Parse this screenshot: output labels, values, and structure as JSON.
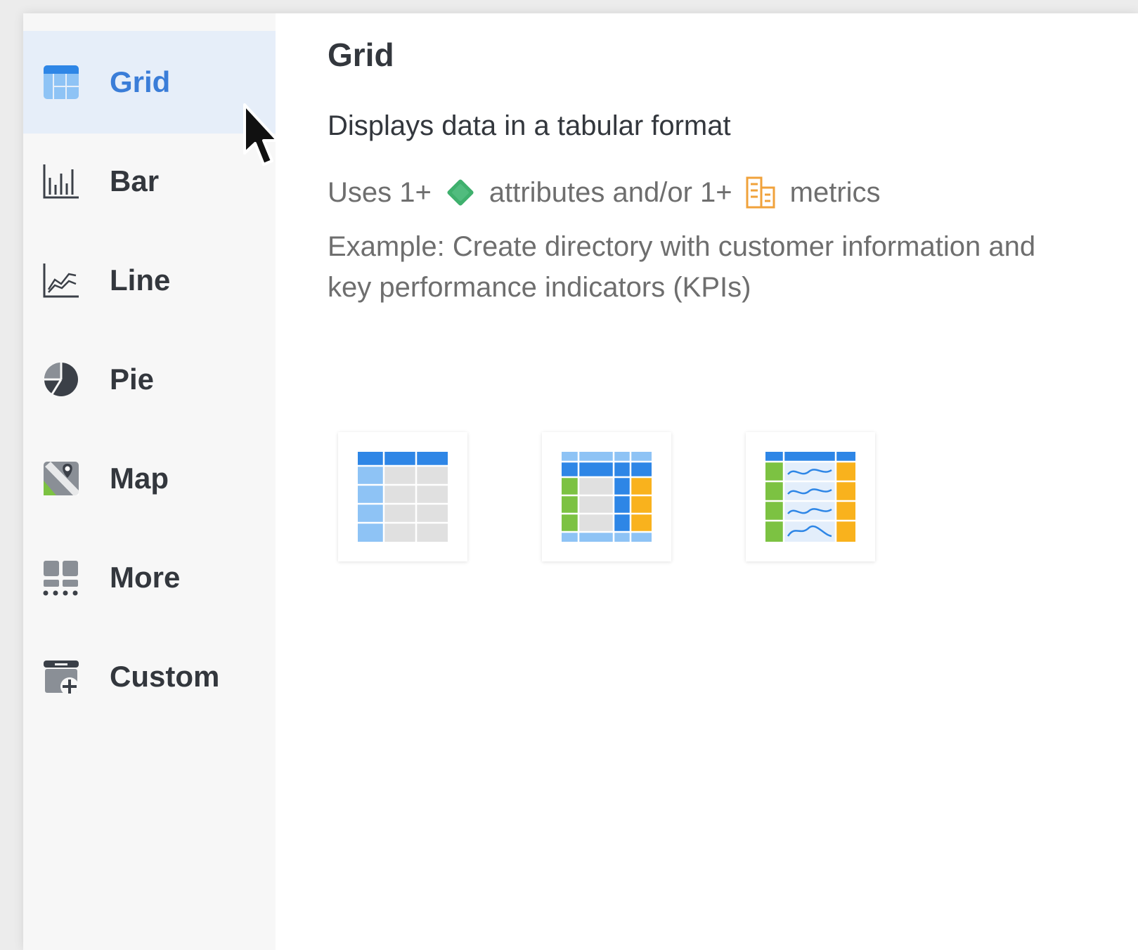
{
  "sidebar": {
    "items": [
      {
        "label": "Grid",
        "icon": "grid-icon",
        "active": true
      },
      {
        "label": "Bar",
        "icon": "bar-chart-icon",
        "active": false
      },
      {
        "label": "Line",
        "icon": "line-chart-icon",
        "active": false
      },
      {
        "label": "Pie",
        "icon": "pie-chart-icon",
        "active": false
      },
      {
        "label": "Map",
        "icon": "map-icon",
        "active": false
      },
      {
        "label": "More",
        "icon": "more-icon",
        "active": false
      },
      {
        "label": "Custom",
        "icon": "custom-icon",
        "active": false
      }
    ]
  },
  "detail": {
    "title": "Grid",
    "description": "Displays data in a tabular format",
    "uses_prefix": "Uses 1+",
    "uses_attributes": "attributes and/or 1+",
    "uses_metrics": "metrics",
    "example": "Example: Create directory with customer information and key performance indicators (KPIs)"
  },
  "thumbnails": [
    {
      "name": "basic-grid"
    },
    {
      "name": "compound-grid"
    },
    {
      "name": "grid-with-sparklines"
    }
  ],
  "colors": {
    "accent": "#3a7dd8",
    "active_bg": "#e6eef9",
    "attribute": "#3fb06d",
    "metric": "#f0a23b",
    "header_blue": "#2e86e6",
    "light_blue": "#8ec3f5",
    "cell_grey": "#e0e0e0",
    "green": "#7cc242",
    "orange": "#f9b21d"
  }
}
